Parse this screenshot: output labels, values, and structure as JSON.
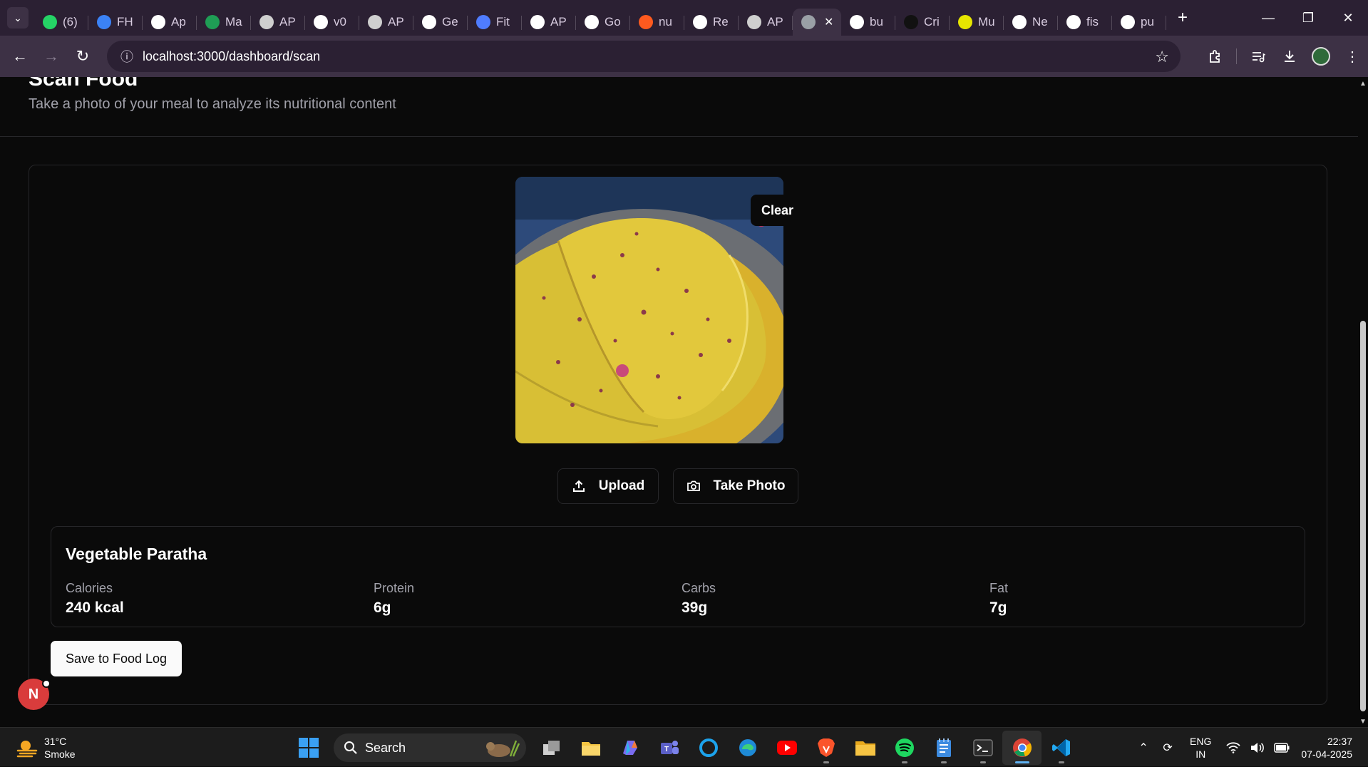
{
  "browser": {
    "tabs": [
      {
        "label": "(6)",
        "icon": "whatsapp-icon",
        "color": "#25d366"
      },
      {
        "label": "FH",
        "icon": "profile-card-icon",
        "color": "#3b82f6"
      },
      {
        "label": "Ap",
        "icon": "google-icon",
        "color": "#ffffff"
      },
      {
        "label": "Ma",
        "icon": "w-logo-icon",
        "color": "#1f9d55"
      },
      {
        "label": "AP",
        "icon": "ap-logo-icon",
        "color": "#cfcfcf"
      },
      {
        "label": "v0",
        "icon": "v0-icon",
        "color": "#ffffff"
      },
      {
        "label": "AP",
        "icon": "ap-logo-icon",
        "color": "#cfcfcf"
      },
      {
        "label": "Ge",
        "icon": "google-icon",
        "color": "#ffffff"
      },
      {
        "label": "Fit",
        "icon": "cart-icon",
        "color": "#4f7cff"
      },
      {
        "label": "AP",
        "icon": "google-icon",
        "color": "#ffffff"
      },
      {
        "label": "Go",
        "icon": "google-icon",
        "color": "#ffffff"
      },
      {
        "label": "nu",
        "icon": "flame-icon",
        "color": "#ff5a1f"
      },
      {
        "label": "Re",
        "icon": "openai-icon",
        "color": "#ffffff"
      },
      {
        "label": "AP",
        "icon": "ap-logo-icon",
        "color": "#cfcfcf"
      },
      {
        "label": "",
        "icon": "globe-icon",
        "color": "#9aa0a6",
        "active": true
      },
      {
        "label": "bu",
        "icon": "google-icon",
        "color": "#ffffff"
      },
      {
        "label": "Cri",
        "icon": "fw-logo-icon",
        "color": "#111111"
      },
      {
        "label": "Mu",
        "icon": "m-logo-icon",
        "color": "#e6e600"
      },
      {
        "label": "Ne",
        "icon": "triangle-logo-icon",
        "color": "#ffffff"
      },
      {
        "label": "fis",
        "icon": "google-icon",
        "color": "#ffffff"
      },
      {
        "label": "pu",
        "icon": "google-icon",
        "color": "#ffffff"
      }
    ],
    "url": "localhost:3000/dashboard/scan"
  },
  "page": {
    "title": "Scan Food",
    "subtitle": "Take a photo of your meal to analyze its nutritional content",
    "clear_label": "Clear",
    "upload_label": "Upload",
    "take_photo_label": "Take Photo",
    "result": {
      "food_name": "Vegetable Paratha",
      "stats": [
        {
          "label": "Calories",
          "value": "240 kcal"
        },
        {
          "label": "Protein",
          "value": "6g"
        },
        {
          "label": "Carbs",
          "value": "39g"
        },
        {
          "label": "Fat",
          "value": "7g"
        }
      ]
    },
    "save_label": "Save to Food Log",
    "avatar_letter": "N"
  },
  "taskbar": {
    "weather": {
      "temp": "31°C",
      "condition": "Smoke"
    },
    "search_label": "Search",
    "lang": {
      "line1": "ENG",
      "line2": "IN"
    },
    "clock": {
      "time": "22:37",
      "date": "07-04-2025"
    }
  },
  "colors": {
    "background": "#0a0a0a",
    "border": "#27272a",
    "muted_text": "#a1a1aa",
    "primary_button": "#fafafa",
    "avatar": "#d93c3c",
    "tabstrip": "#2b2033",
    "toolbar": "#3d3145"
  }
}
